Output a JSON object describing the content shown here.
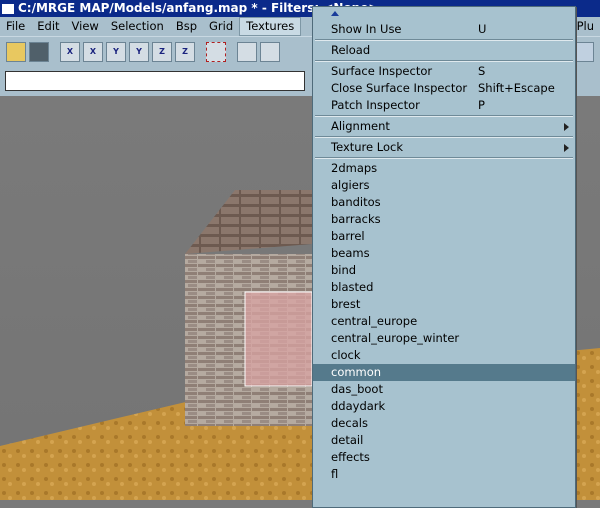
{
  "window": {
    "title": "C:/MRGE MAP/Models/anfang.map * - Filters: <None>"
  },
  "menubar": {
    "items": [
      "File",
      "Edit",
      "View",
      "Selection",
      "Bsp",
      "Grid",
      "Textures"
    ],
    "right_item": "Plu"
  },
  "toolbar": {
    "icons": [
      "open-folder-icon",
      "save-icon",
      "flip-x-icon",
      "flip-y-icon",
      "flip-z-icon",
      "rotate-x-icon",
      "rotate-y-icon",
      "rotate-z-icon",
      "select-complete-icon",
      "select-inside-icon",
      "select-touching-icon"
    ],
    "labels": [
      "X",
      "X",
      "Y",
      "Y",
      "Z",
      "Z"
    ]
  },
  "command_input": {
    "value": ""
  },
  "textures_menu": {
    "top": [
      {
        "label": "Show In Use",
        "shortcut": "U"
      }
    ],
    "group2": [
      {
        "label": "Reload",
        "shortcut": ""
      }
    ],
    "group3": [
      {
        "label": "Surface Inspector",
        "shortcut": "S"
      },
      {
        "label": "Close Surface Inspector",
        "shortcut": "Shift+Escape"
      },
      {
        "label": "Patch Inspector",
        "shortcut": "P"
      }
    ],
    "alignment": "Alignment",
    "texture_lock": "Texture Lock",
    "folders": [
      "2dmaps",
      "algiers",
      "banditos",
      "barracks",
      "barrel",
      "beams",
      "bind",
      "blasted",
      "brest",
      "central_europe",
      "central_europe_winter",
      "clock",
      "common",
      "das_boot",
      "ddaydark",
      "decals",
      "detail",
      "effects",
      "fl"
    ],
    "selected_folder": "common"
  },
  "colors": {
    "menu_bg": "#a7c2cf",
    "highlight": "#557a8c",
    "titlebar": "#0b2a8a"
  }
}
